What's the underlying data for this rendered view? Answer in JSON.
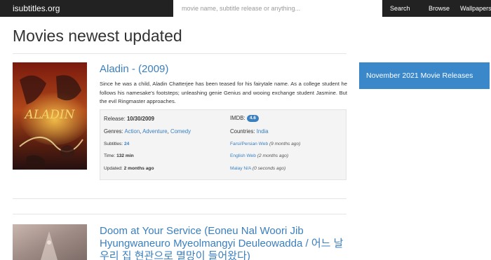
{
  "navbar": {
    "brand": "isubtitles.org",
    "search_placeholder": "movie name, subtitle release or anything...",
    "search_label": "Search",
    "browse_label": "Browse",
    "wallpapers_label": "Wallpapers"
  },
  "page": {
    "title": "Movies newest updated"
  },
  "movies": [
    {
      "title": "Aladin - (2009)",
      "synopsis": "Since he was a child, Aladin Chatterjee has been teased for his fairytale name. As a college student he follows his namesake's footsteps; unleashing genie Genius and wooing exchange student Jasmine. But the evil Ringmaster approaches.",
      "release_label": "Release:",
      "release_value": "10/30/2009",
      "imdb_label": "IMDB:",
      "imdb_value": "4.6",
      "genres_label": "Genres:",
      "genres": [
        "Action",
        "Adventure",
        "Comedy"
      ],
      "countries_label": "Countries:",
      "country": "India",
      "subtitles_label": "Subtitles:",
      "subtitles_value": "24",
      "time_label": "Time:",
      "time_value": "132 min",
      "updated_label": "Updated:",
      "updated_value": "2 months ago",
      "subtitle_langs": [
        {
          "name": "Farsi/Persian Web",
          "age": "(9 months ago)"
        },
        {
          "name": "English Web",
          "age": "(2 months ago)"
        },
        {
          "name": "Malay N/A",
          "age": "(0 seconds ago)"
        }
      ]
    },
    {
      "title": "Doom at Your Service (Eoneu Nal Woori Jib Hyungwaneuro Myeolmangyi Deuleowadda / 어느 날 우리 집 현관으로 멸망이 들어왔다)"
    }
  ],
  "sidebar": {
    "box_label": "November 2021 Movie Releases"
  },
  "colors": {
    "navbar_bg": "#222222",
    "link": "#3a7fbf",
    "sidebar_box": "#3a87ca",
    "badge": "#3a7fbf"
  },
  "icons": []
}
